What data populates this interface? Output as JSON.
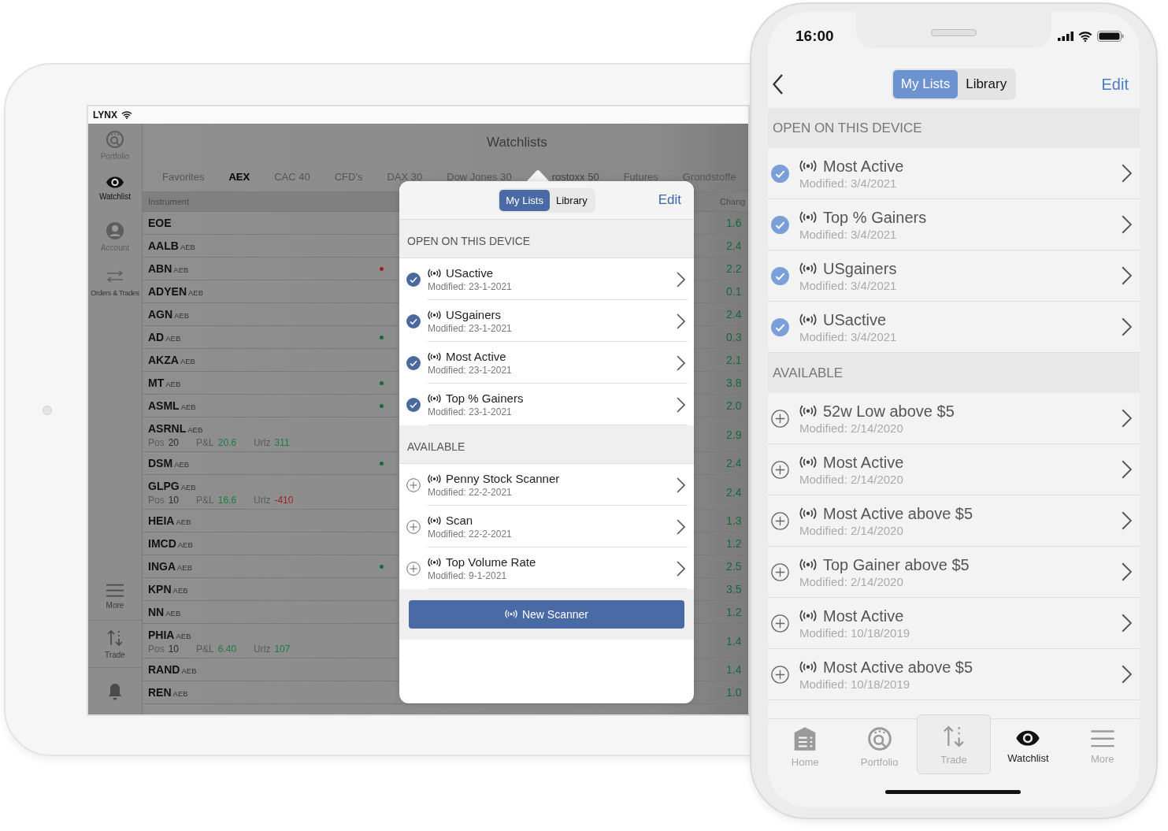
{
  "tablet": {
    "status_bar": {
      "carrier": "LYNX"
    },
    "sidebar": {
      "items": [
        {
          "label": "Portfolio",
          "kind": "portfolio",
          "selected": false
        },
        {
          "label": "Watchlist",
          "kind": "eye",
          "selected": true
        },
        {
          "label": "Account",
          "kind": "account",
          "selected": false
        },
        {
          "label": "Orders & Trades",
          "kind": "orders",
          "selected": false
        }
      ],
      "bottom_items": [
        {
          "label": "More",
          "kind": "menu"
        },
        {
          "label": "Trade",
          "kind": "trade"
        },
        {
          "kind": "bell"
        }
      ]
    },
    "title": "Watchlists",
    "tabs": [
      {
        "label": "Favorites",
        "selected": false
      },
      {
        "label": "AEX",
        "selected": true
      },
      {
        "label": "CAC 40",
        "selected": false
      },
      {
        "label": "CFD's",
        "selected": false
      },
      {
        "label": "DAX 30",
        "selected": false
      },
      {
        "label": "Dow Jones 30",
        "selected": false
      },
      {
        "label": "rostoxx 50",
        "selected": false
      },
      {
        "label": "Futures",
        "selected": false
      },
      {
        "label": "Grondstoffe",
        "selected": false
      }
    ],
    "table": {
      "columns": [
        "Instrument",
        "Chang"
      ],
      "rows": [
        {
          "symbol": "EOE",
          "change": "1.6"
        },
        {
          "symbol": "AALB",
          "exchange": "AEB",
          "change": "2.4"
        },
        {
          "symbol": "ABN",
          "exchange": "AEB",
          "color": "#a31d1d",
          "change": "2.2"
        },
        {
          "symbol": "ADYEN",
          "exchange": "AEB",
          "change": "0.1"
        },
        {
          "symbol": "AGN",
          "exchange": "AEB",
          "change": "2.4"
        },
        {
          "symbol": "AD",
          "exchange": "AEB",
          "color": "#17693a",
          "change": "0.3"
        },
        {
          "symbol": "AKZA",
          "exchange": "AEB",
          "change": "2.1"
        },
        {
          "symbol": "MT",
          "exchange": "AEB",
          "color": "#17693a",
          "change": "3.8"
        },
        {
          "symbol": "ASML",
          "exchange": "AEB",
          "color": "#17693a",
          "change": "2.0"
        },
        {
          "symbol": "ASRNL",
          "exchange": "AEB",
          "position": [
            {
              "label": "Pos",
              "value": "20",
              "color": "#2a2a2a"
            },
            {
              "label": "P&L",
              "value": "20.6",
              "color": "#1f7a45"
            },
            {
              "label": "Urlz",
              "value": "311",
              "color": "#1f7a45"
            }
          ],
          "change": "2.9"
        },
        {
          "symbol": "DSM",
          "exchange": "AEB",
          "color": "#17693a",
          "change": "2.4"
        },
        {
          "symbol": "GLPG",
          "exchange": "AEB",
          "position": [
            {
              "label": "Pos",
              "value": "10",
              "color": "#2a2a2a"
            },
            {
              "label": "P&L",
              "value": "16.6",
              "color": "#1f7a45"
            },
            {
              "label": "Urlz",
              "value": "-410",
              "color": "#a32020"
            }
          ],
          "change": "2.4"
        },
        {
          "symbol": "HEIA",
          "exchange": "AEB",
          "change": "1.3"
        },
        {
          "symbol": "IMCD",
          "exchange": "AEB",
          "change": "1.2"
        },
        {
          "symbol": "INGA",
          "exchange": "AEB",
          "color": "#17693a",
          "change": "2.5"
        },
        {
          "symbol": "KPN",
          "exchange": "AEB",
          "change": "3.5"
        },
        {
          "symbol": "NN",
          "exchange": "AEB",
          "change": "1.2"
        },
        {
          "symbol": "PHIA",
          "exchange": "AEB",
          "position": [
            {
              "label": "Pos",
              "value": "10",
              "color": "#2a2a2a"
            },
            {
              "label": "P&L",
              "value": "6.40",
              "color": "#1f7a45"
            },
            {
              "label": "Urlz",
              "value": "107",
              "color": "#1f7a45"
            }
          ],
          "change": "1.4"
        },
        {
          "symbol": "RAND",
          "exchange": "AEB",
          "change": "1.4"
        },
        {
          "symbol": "REN",
          "exchange": "AEB",
          "change": "1.0"
        }
      ]
    },
    "popover": {
      "segments": [
        {
          "label": "My Lists",
          "selected": true
        },
        {
          "label": "Library",
          "selected": false
        }
      ],
      "edit": "Edit",
      "sections": [
        {
          "title": "OPEN ON THIS DEVICE",
          "items": [
            {
              "name": "USactive",
              "modified": "Modified: 23-1-2021",
              "checked": true
            },
            {
              "name": "USgainers",
              "modified": "Modified: 23-1-2021",
              "checked": true
            },
            {
              "name": "Most Active",
              "modified": "Modified: 23-1-2021",
              "checked": true
            },
            {
              "name": "Top % Gainers",
              "modified": "Modified: 23-1-2021",
              "checked": true
            }
          ]
        },
        {
          "title": "AVAILABLE",
          "items": [
            {
              "name": "Penny Stock Scanner",
              "modified": "Modified: 22-2-2021",
              "checked": false
            },
            {
              "name": "Scan",
              "modified": "Modified: 22-2-2021",
              "checked": false
            },
            {
              "name": "Top Volume Rate",
              "modified": "Modified: 9-1-2021",
              "checked": false
            }
          ]
        }
      ],
      "button": "New Scanner"
    }
  },
  "phone": {
    "time": "16:00",
    "segments": [
      {
        "label": "My Lists",
        "selected": true
      },
      {
        "label": "Library",
        "selected": false
      }
    ],
    "edit": "Edit",
    "sections": [
      {
        "title": "OPEN ON THIS DEVICE",
        "items": [
          {
            "name": "Most Active",
            "modified": "Modified: 3/4/2021",
            "checked": true
          },
          {
            "name": "Top % Gainers",
            "modified": "Modified: 3/4/2021",
            "checked": true
          },
          {
            "name": "USgainers",
            "modified": "Modified: 3/4/2021",
            "checked": true
          },
          {
            "name": "USactive",
            "modified": "Modified: 3/4/2021",
            "checked": true
          }
        ]
      },
      {
        "title": "AVAILABLE",
        "items": [
          {
            "name": "52w Low above $5",
            "modified": "Modified: 2/14/2020",
            "checked": false
          },
          {
            "name": "Most Active",
            "modified": "Modified: 2/14/2020",
            "checked": false
          },
          {
            "name": "Most Active above $5",
            "modified": "Modified: 2/14/2020",
            "checked": false
          },
          {
            "name": "Top Gainer above $5",
            "modified": "Modified: 2/14/2020",
            "checked": false
          },
          {
            "name": "Most Active",
            "modified": "Modified: 10/18/2019",
            "checked": false
          },
          {
            "name": "Most Active above $5",
            "modified": "Modified: 10/18/2019",
            "checked": false
          }
        ]
      }
    ],
    "tab_bar": [
      {
        "label": "Home",
        "kind": "home",
        "selected": false,
        "highlighted": false
      },
      {
        "label": "Portfolio",
        "kind": "portfolio",
        "selected": false,
        "highlighted": false
      },
      {
        "label": "Trade",
        "kind": "trade",
        "selected": false,
        "highlighted": true
      },
      {
        "label": "Watchlist",
        "kind": "eye",
        "selected": true,
        "highlighted": false
      },
      {
        "label": "More",
        "kind": "menu",
        "selected": false,
        "highlighted": false
      }
    ]
  }
}
